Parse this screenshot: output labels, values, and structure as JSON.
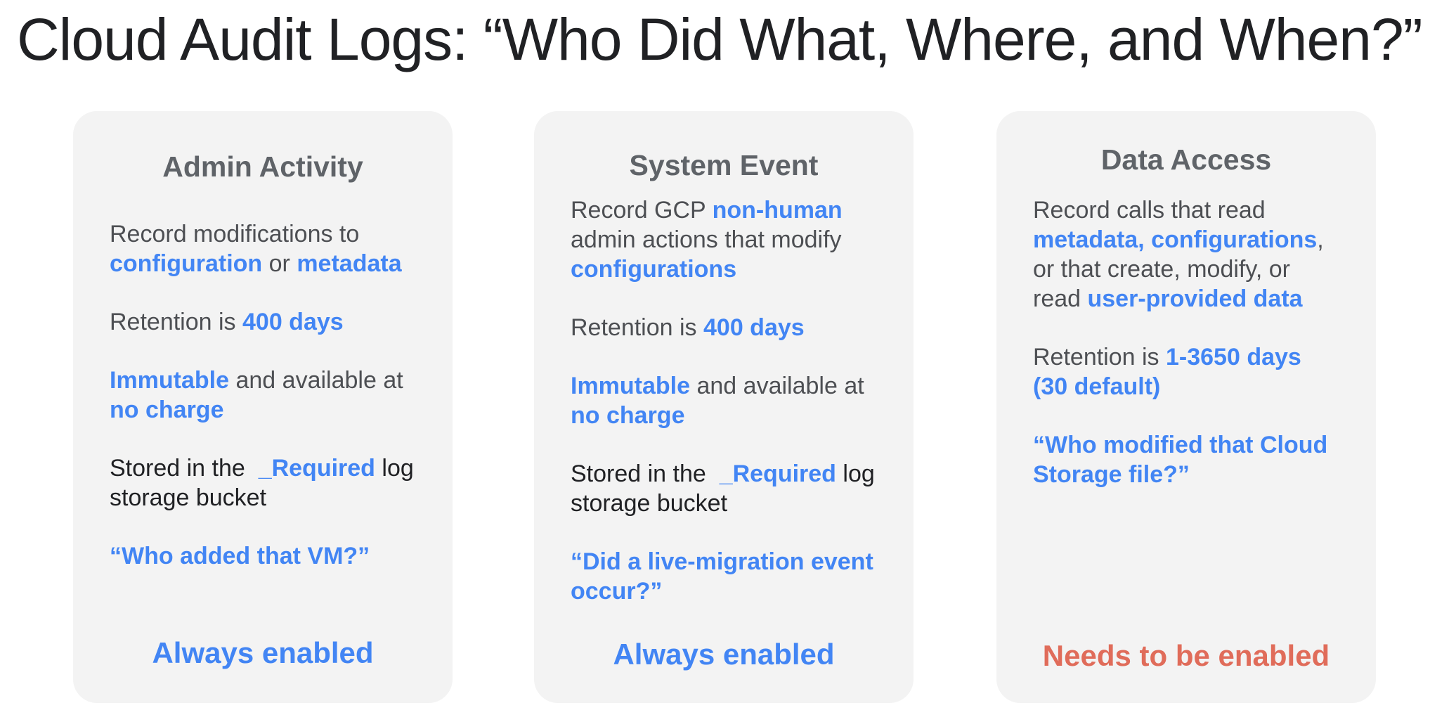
{
  "title": "Cloud Audit Logs: “Who Did What, Where, and When?”",
  "colors": {
    "accent_blue": "#4285f4",
    "accent_red": "#e06c5a",
    "card_background": "#f3f3f3",
    "text_dark": "#202124",
    "text_gray": "#5f6368"
  },
  "cards": [
    {
      "heading": "Admin Activity",
      "description": {
        "t1": "Record modifications to ",
        "h1": "configuration",
        "t2": " or ",
        "h2": "metadata"
      },
      "retention": {
        "prefix": "Retention is ",
        "value": "400 days"
      },
      "charge": {
        "h1": "Immutable",
        "t1": " and available at ",
        "h2": "no charge"
      },
      "storage": {
        "prefix": "Stored in the  ",
        "bucket": "_Required",
        "suffix": " log storage bucket"
      },
      "quote": "“Who added that VM?”",
      "status": "Always enabled"
    },
    {
      "heading": "System Event",
      "description": {
        "t1": "Record GCP ",
        "h1": "non-human",
        "t2": " admin actions that modify ",
        "h2": "configurations"
      },
      "retention": {
        "prefix": "Retention is ",
        "value": "400 days"
      },
      "charge": {
        "h1": "Immutable",
        "t1": " and available at ",
        "h2": "no charge"
      },
      "storage": {
        "prefix": "Stored in the  ",
        "bucket": "_Required",
        "suffix": " log storage bucket"
      },
      "quote": "“Did a live-migration event occur?”",
      "status": "Always enabled"
    },
    {
      "heading": "Data Access",
      "description": {
        "t1": "Record calls that read ",
        "h1": "metadata, configurations",
        "t2": ", or that create, modify, or read ",
        "h2": "user-provided data"
      },
      "retention": {
        "prefix": "Retention is ",
        "value": "1-3650 days (30 default)"
      },
      "quote": "“Who modified that Cloud Storage file?”",
      "status": "Needs to be enabled"
    }
  ]
}
